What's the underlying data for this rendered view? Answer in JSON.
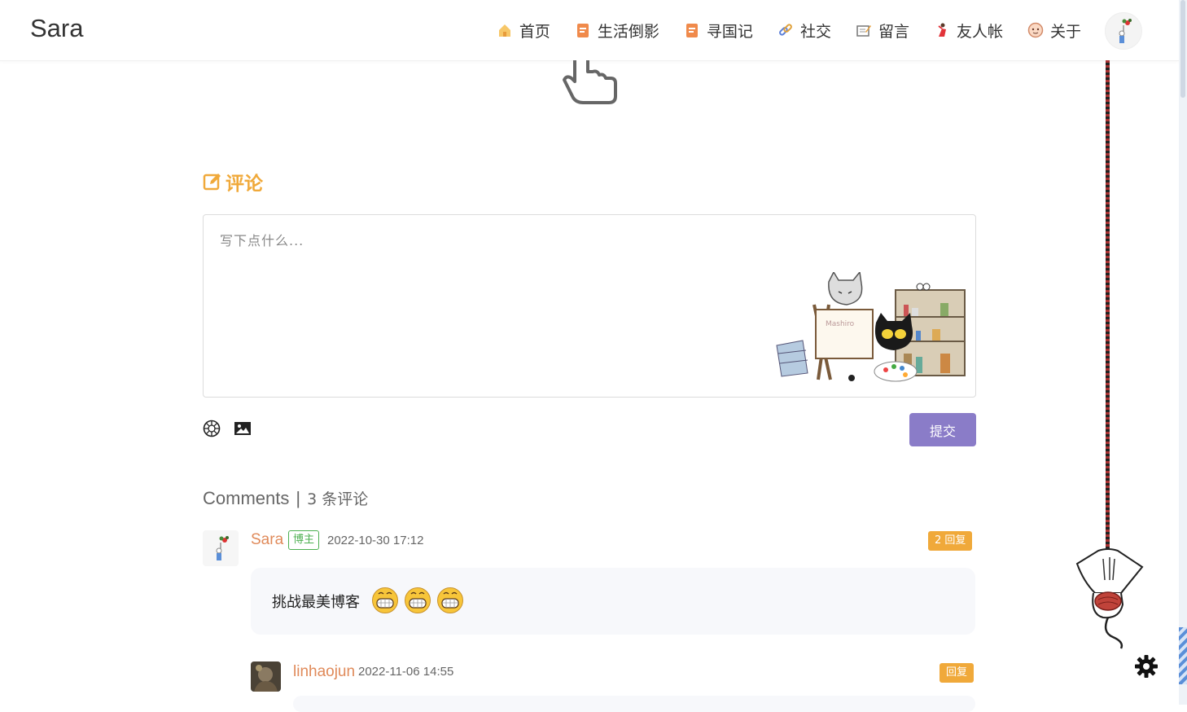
{
  "header": {
    "logo": "Sara",
    "nav": [
      {
        "label": "首页",
        "icon": "home-icon"
      },
      {
        "label": "生活倒影",
        "icon": "document-icon"
      },
      {
        "label": "寻国记",
        "icon": "document-icon"
      },
      {
        "label": "社交",
        "icon": "link-icon"
      },
      {
        "label": "留言",
        "icon": "memo-icon"
      },
      {
        "label": "友人帐",
        "icon": "dancer-icon"
      },
      {
        "label": "关于",
        "icon": "face-icon"
      }
    ]
  },
  "comment_form": {
    "title": "评论",
    "placeholder": "写下点什么...",
    "submit_label": "提交"
  },
  "comments_header": {
    "label": "Comments",
    "separator": "|",
    "count_text": "3 条评论"
  },
  "comments": [
    {
      "author": "Sara",
      "badge": "博主",
      "time": "2022-10-30 17:12",
      "reply_label": "2 回复",
      "text": "挑战最美博客"
    },
    {
      "author": "linhaojun",
      "time": "2022-11-06 14:55",
      "reply_label": "回复"
    }
  ],
  "colors": {
    "accent": "#f0a93a",
    "author": "#e08a5a",
    "submit": "#8a7cc8",
    "owner_badge": "#4caf50"
  }
}
